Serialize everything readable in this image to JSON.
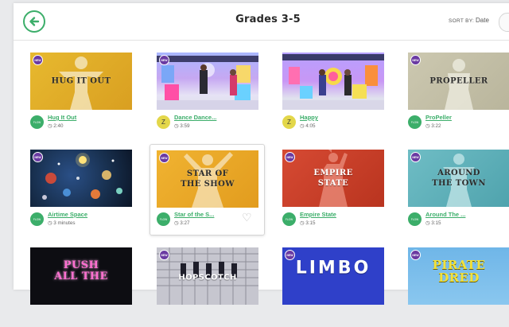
{
  "header": {
    "title": "Grades 3-5",
    "sort_label": "SORT BY:",
    "sort_value": "Date"
  },
  "badge_label": "NEW",
  "rows": [
    [
      {
        "label": "HUG IT OUT",
        "title": "Hug It Out",
        "duration": "2:40",
        "kind": "flow",
        "badge": true
      },
      {
        "label": "",
        "title": "Dance Dance...",
        "duration": "3:59",
        "kind": "zumba",
        "badge": true
      },
      {
        "label": "",
        "title": "Happy",
        "duration": "4:05",
        "kind": "zumba",
        "badge": false
      },
      {
        "label": "PROPELLER",
        "title": "ProPeller",
        "duration": "3:22",
        "kind": "flow",
        "badge": true
      }
    ],
    [
      {
        "label": "",
        "title": "Airtime Space",
        "duration": "3 minutes",
        "kind": "flow",
        "badge": true
      },
      {
        "label": "STAR OF\nTHE SHOW",
        "title": "Star of the S...",
        "duration": "3:27",
        "kind": "flow",
        "badge": true
      },
      {
        "label": "EMPIRE\nSTATE",
        "title": "Empire State",
        "duration": "3:15",
        "kind": "flow",
        "badge": true
      },
      {
        "label": "AROUND\nTHE TOWN",
        "title": "Around The ...",
        "duration": "3:15",
        "kind": "flow",
        "badge": true
      }
    ],
    [
      {
        "label": "PUSH\nALL THE",
        "badge": false
      },
      {
        "label": "HOPSCOTCH",
        "badge": true
      },
      {
        "label": "LIMBO",
        "badge": true
      },
      {
        "label": "PIRATE\nDRED",
        "badge": true
      }
    ]
  ],
  "kind_labels": {
    "flow": "FLOW",
    "zumba": "Z"
  },
  "colors": {
    "accent": "#3cae6a",
    "badge": "#6a3aa2"
  },
  "icons": {
    "back": "arrow-left-icon",
    "heart": "heart-icon",
    "clock": "clock-icon"
  }
}
